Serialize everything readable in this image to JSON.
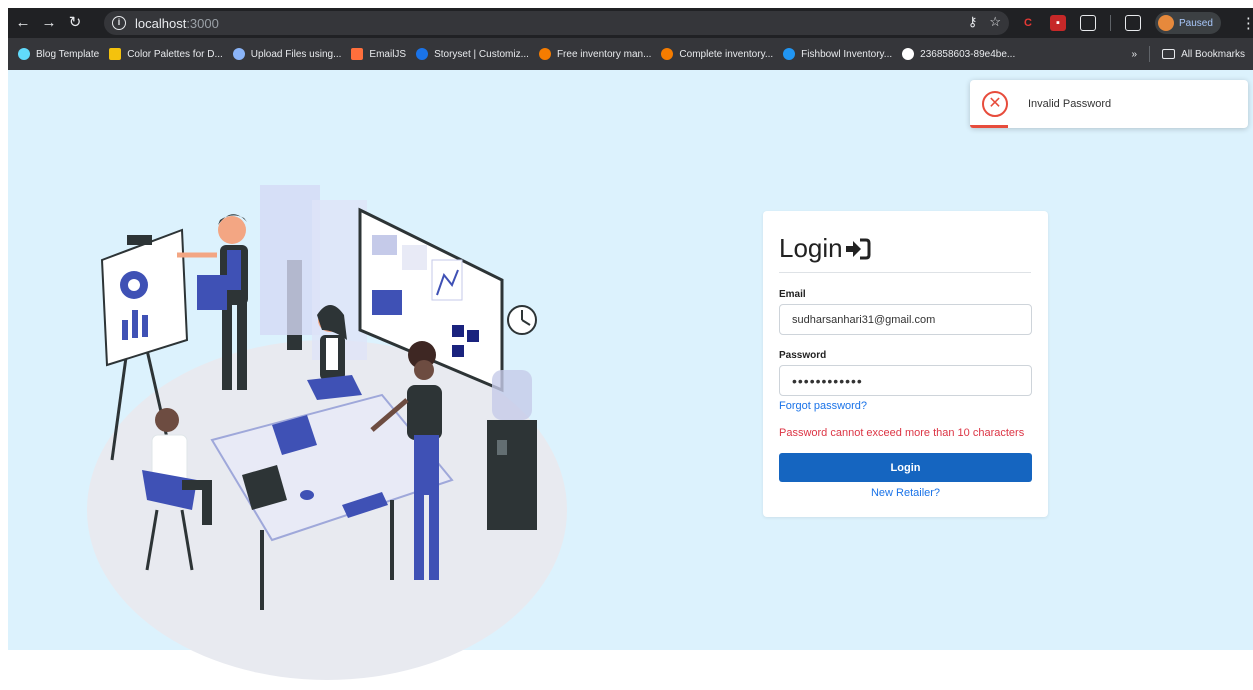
{
  "browser": {
    "url_host": "localhost",
    "url_port": ":3000",
    "profile_status": "Paused",
    "bookmarks": [
      {
        "label": "Blog Template",
        "color": "#61dafb"
      },
      {
        "label": "Color Palettes for D...",
        "color": "#f4c20d"
      },
      {
        "label": "Upload Files using...",
        "color": "#8ab4f8"
      },
      {
        "label": "EmailJS",
        "color": "#ff6f3c"
      },
      {
        "label": "Storyset | Customiz...",
        "color": "#1a73e8"
      },
      {
        "label": "Free inventory man...",
        "color": "#f57c00"
      },
      {
        "label": "Complete inventory...",
        "color": "#f57c00"
      },
      {
        "label": "Fishbowl Inventory...",
        "color": "#2196f3"
      },
      {
        "label": "236858603-89e4be...",
        "color": "#ffffff"
      }
    ],
    "more_bookmarks": "»",
    "all_bookmarks": "All Bookmarks"
  },
  "toast": {
    "message": "Invalid Password",
    "icon": "error-x-icon"
  },
  "login": {
    "title": "Login",
    "email_label": "Email",
    "email_value": "sudharsanhari31@gmail.com",
    "password_label": "Password",
    "password_value": "••••••••••••",
    "forgot_link": "Forgot password?",
    "error_message": "Password cannot exceed more than 10 characters",
    "submit_label": "Login",
    "register_link": "New Retailer?"
  },
  "colors": {
    "page_bg": "#dcf2fd",
    "primary": "#1565c0",
    "error": "#dc3545",
    "link": "#1a73e8"
  }
}
